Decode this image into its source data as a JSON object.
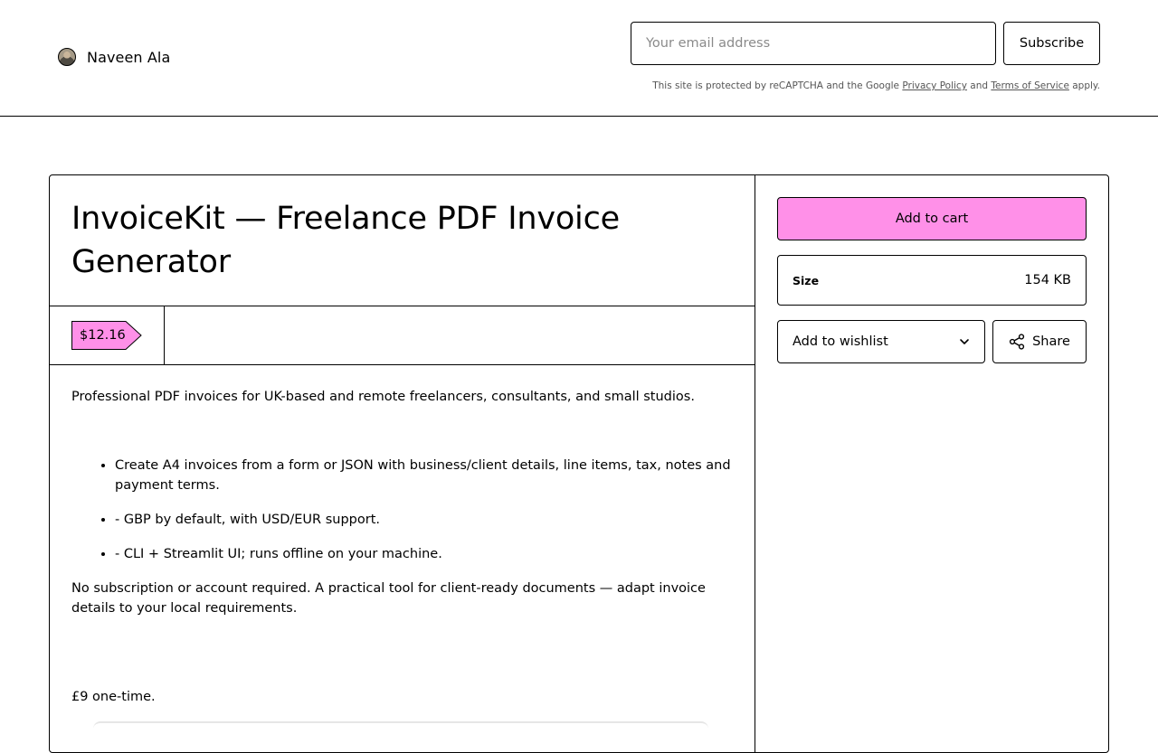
{
  "header": {
    "creator_name": "Naveen Ala",
    "email_placeholder": "Your email address",
    "subscribe_label": "Subscribe",
    "recaptcha": {
      "prefix": "This site is protected by reCAPTCHA and the Google",
      "privacy_link": "Privacy Policy",
      "and": "and",
      "terms_link": "Terms of Service",
      "suffix": "apply."
    }
  },
  "product": {
    "title": "InvoiceKit — Freelance PDF Invoice Generator",
    "price": "$12.16",
    "description": {
      "intro": "Professional PDF invoices for UK-based and remote freelancers, consultants, and small studios.",
      "bullets": [
        "Create A4 invoices from a form or JSON with business/client details, line items, tax, notes and payment terms.",
        "- GBP by default, with USD/EUR support.",
        "- CLI + Streamlit UI; runs offline on your machine."
      ],
      "outro": "No subscription or account required. A practical tool for client-ready documents — adapt invoice details to your local requirements.",
      "pricing_note": "£9 one-time."
    }
  },
  "sidebar": {
    "add_to_cart_label": "Add to cart",
    "size_label": "Size",
    "size_value": "154 KB",
    "wishlist_label": "Add to wishlist",
    "share_label": "Share"
  },
  "colors": {
    "accent_pink": "#ff90e8",
    "border": "#000000",
    "background": "#ffffff"
  },
  "icons": {
    "wishlist": "chevron-down-icon",
    "share": "share-icon"
  }
}
